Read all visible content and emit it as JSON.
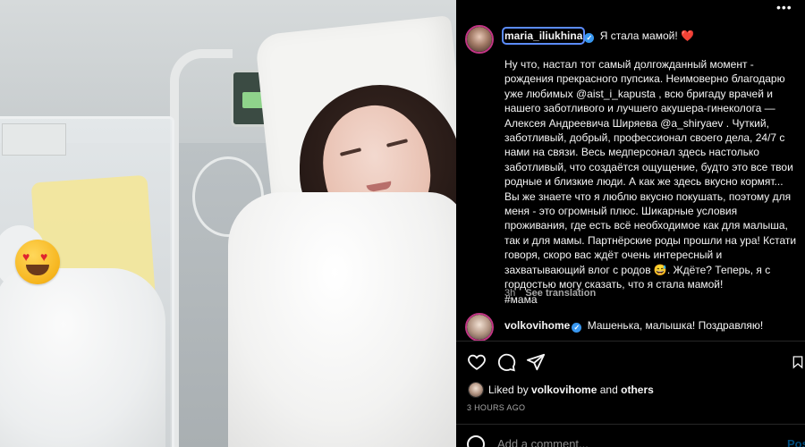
{
  "post": {
    "author": "maria_iliukhina",
    "caption_head": "Я стала мамой!",
    "caption_heart": "❤️",
    "caption_body": "Ну что, настал тот самый долгожданный момент -\nрождения прекрасного пупсика. Неимоверно благодарю\nуже любимых @aist_i_kapusta , всю бригаду врачей и\nнашего заботливого и лучшего акушера-гинеколога —\nАлексея Андреевича Ширяева @a_shiryaev . Чуткий,\nзаботливый, добрый, профессионал своего дела, 24/7 с\nнами на связи. Весь медперсонал здесь настолько\nзаботливый, что создаётся ощущение, будто это все твои\nродные и близкие люди. А как же здесь вкусно кормят...\nВы же знаете что я люблю вкусно покушать, поэтому для\nменя - это огромный плюс. Шикарные условия\nпроживания, где есть всё необходимое как для малыша,\nтак и для мамы. Партнёрские роды прошли на ура! Кстати\nговоря, скоро вас ждёт очень интересный и\nзахватывающий влог с родов 😅. Ждёте? Теперь, я с\nгордостью могу сказать, что я стала мамой!\n#мама",
    "age": "3h",
    "see_translation": "See translation"
  },
  "comment": {
    "author": "volkovihome",
    "text": "Машенька, малышка! Поздравляю!"
  },
  "likes": {
    "prefix": "Liked by",
    "user": "volkovihome",
    "and": "and",
    "others": "others"
  },
  "timestamp": "3 HOURS AGO",
  "composer": {
    "placeholder": "Add a comment...",
    "post_label": "Post"
  },
  "icons": {
    "like": "heart-outline-icon",
    "comment": "comment-bubble-icon",
    "share": "paper-plane-icon",
    "save": "bookmark-icon",
    "emoji": "emoji-smile-icon",
    "verified": "verified-badge-icon"
  },
  "colors": {
    "background": "#000000",
    "text": "#f5f5f5",
    "secondary": "#a8a8a8",
    "verified": "#3897f0",
    "accent": "#0095f6"
  }
}
